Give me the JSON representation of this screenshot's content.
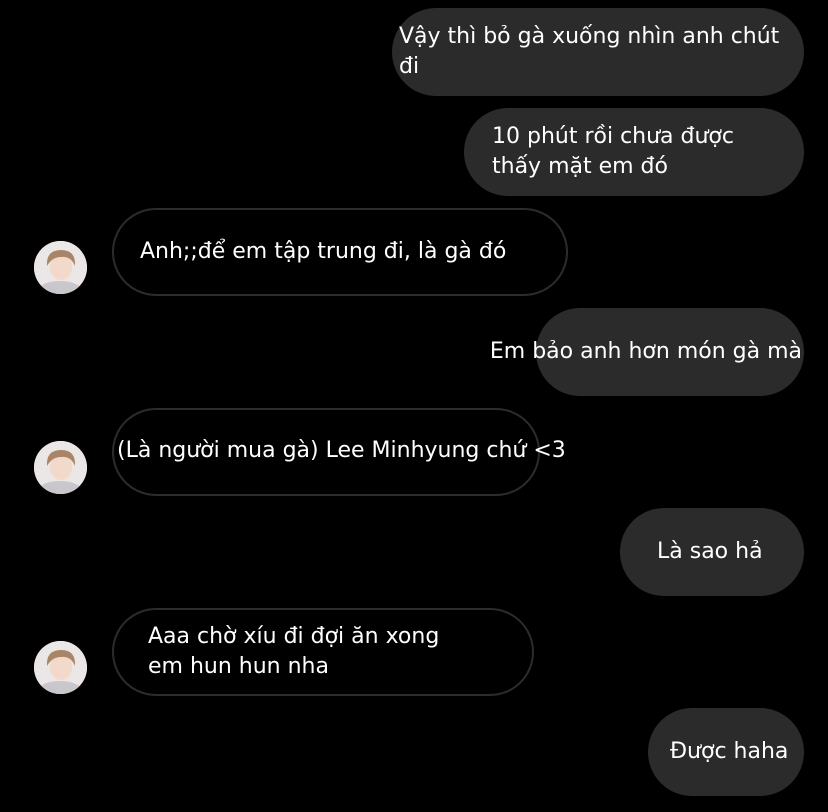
{
  "colors": {
    "background": "#000000",
    "sent_bubble": "#2b2b2b",
    "received_border": "#2c2c2c",
    "text": "#ffffff"
  },
  "messages": [
    {
      "side": "sent",
      "text": "Vậy thì bỏ gà xuống nhìn anh chút đi"
    },
    {
      "side": "sent",
      "text": "10 phút rồi chưa được\nthấy mặt em đó"
    },
    {
      "side": "received",
      "text": "Anh;;để em tập trung đi, là gà đó"
    },
    {
      "side": "sent",
      "text": "Em bảo anh hơn món gà mà"
    },
    {
      "side": "received",
      "text": "(Là người mua gà) Lee Minhyung chứ <3"
    },
    {
      "side": "sent",
      "text": "Là sao hả"
    },
    {
      "side": "received",
      "text": "Aaa chờ xíu đi đợi ăn xong\nem hun hun nha"
    },
    {
      "side": "sent",
      "text": "Được haha"
    }
  ],
  "avatar_icon": "profile-photo"
}
